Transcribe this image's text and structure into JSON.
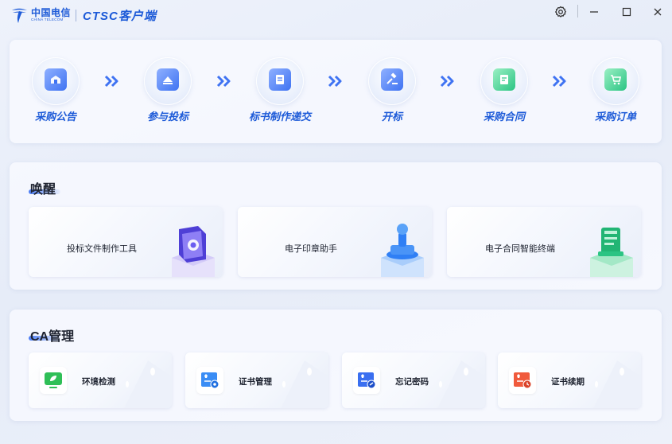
{
  "titlebar": {
    "logo_cn": "中国电信",
    "logo_en": "CHINA TELECOM",
    "app_title": "CTSC客户端"
  },
  "steps": [
    {
      "label": "采购公告",
      "icon": "announcement-icon",
      "color": "#3f73f2"
    },
    {
      "label": "参与投标",
      "icon": "bid-participate-icon",
      "color": "#3f73f2"
    },
    {
      "label": "标书制作递交",
      "icon": "document-submit-icon",
      "color": "#3f73f2"
    },
    {
      "label": "开标",
      "icon": "gavel-icon",
      "color": "#3f73f2"
    },
    {
      "label": "采购合同",
      "icon": "contract-icon",
      "color": "#3f73f2"
    },
    {
      "label": "采购订单",
      "icon": "cart-icon",
      "color": "#3f73f2"
    }
  ],
  "wake": {
    "title": "唤醒",
    "cards": [
      {
        "label": "投标文件制作工具",
        "icon": "bid-tool-icon",
        "accent": "#6a5cf0"
      },
      {
        "label": "电子印章助手",
        "icon": "seal-icon",
        "accent": "#2f7ff5"
      },
      {
        "label": "电子合同智能终端",
        "icon": "contract-terminal-icon",
        "accent": "#2bc483"
      }
    ]
  },
  "ca": {
    "title": "CA管理",
    "cards": [
      {
        "label": "环境检测",
        "icon": "environment-check-icon",
        "accent": "#2fbf57"
      },
      {
        "label": "证书管理",
        "icon": "certificate-manage-icon",
        "accent": "#3a8df5"
      },
      {
        "label": "忘记密码",
        "icon": "forgot-password-icon",
        "accent": "#3a6ff0"
      },
      {
        "label": "证书续期",
        "icon": "certificate-renew-icon",
        "accent": "#f05a3c"
      }
    ]
  },
  "colors": {
    "brand": "#1e5bd8",
    "accent": "#4a7cf5"
  }
}
